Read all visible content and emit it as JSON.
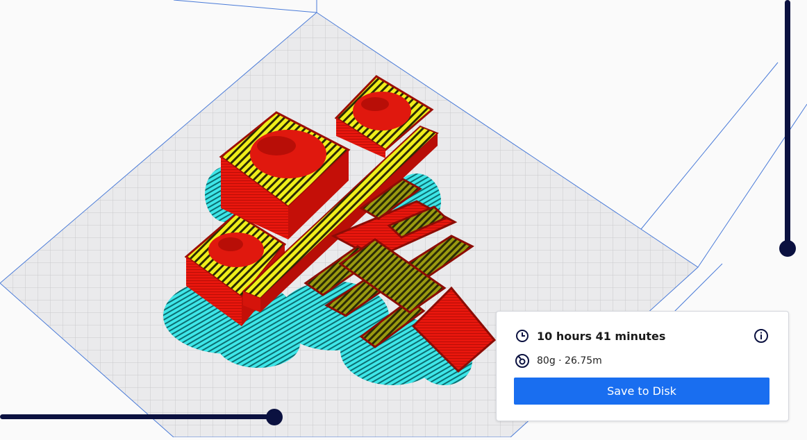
{
  "print_info": {
    "time": "10 hours 41 minutes",
    "material": "80g · 26.75m",
    "save_label": "Save to Disk"
  },
  "colors": {
    "accent": "#196ef0",
    "slider": "#0b1140",
    "wall": "#e8160d",
    "infill": "#f2f21a",
    "support": "#38e0e3",
    "build_plate": "#e9e9eb"
  },
  "icons": {
    "time": "clock-icon",
    "material": "spool-icon",
    "info": "info-icon"
  }
}
